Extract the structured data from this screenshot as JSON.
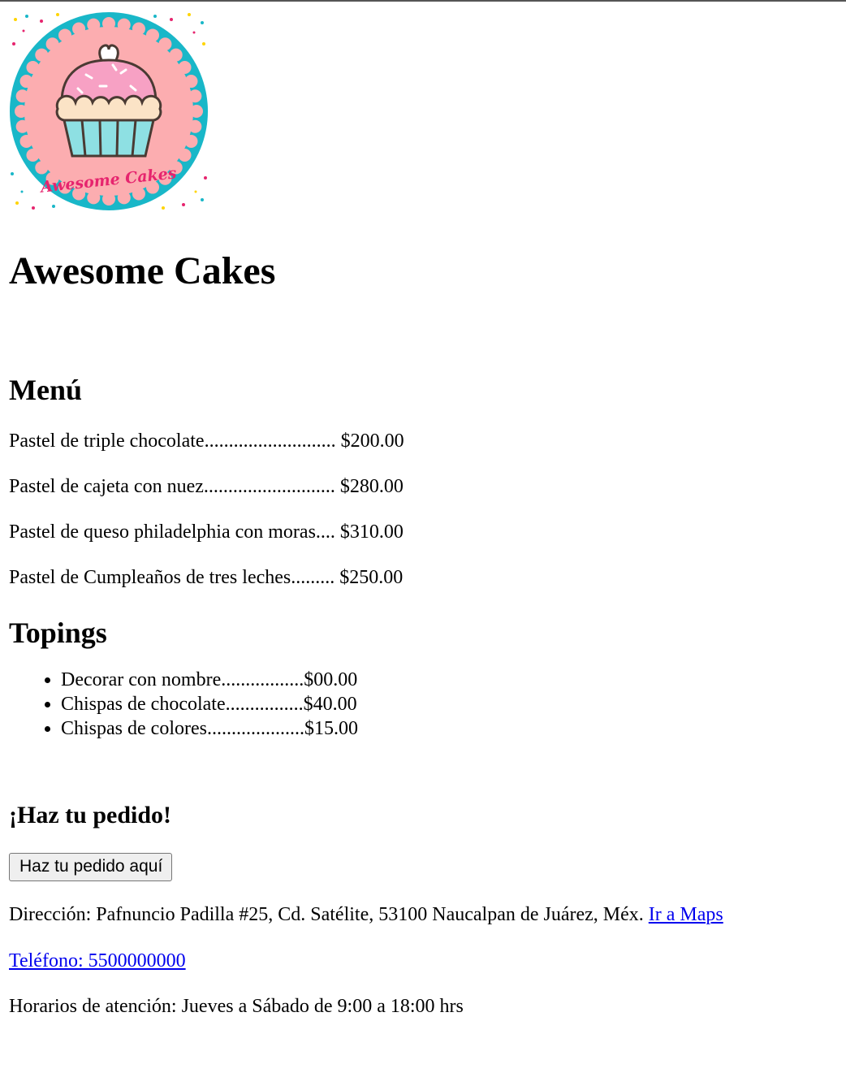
{
  "logo": {
    "text": "Awesome Cakes",
    "colors": {
      "ring": "#19b7c8",
      "inner": "#fcadb0",
      "frosting": "#f7a1c4",
      "cup": "#8ee0e3",
      "cream": "#fbe3c6",
      "outline": "#4a3a33",
      "script_text": "#e6246e"
    }
  },
  "title": "Awesome Cakes",
  "menu": {
    "heading": "Menú",
    "items": [
      "Pastel de triple chocolate........................... $200.00",
      "Pastel de cajeta con nuez........................... $280.00",
      "Pastel de queso philadelphia con moras.... $310.00",
      "Pastel de Cumpleaños de tres leches......... $250.00"
    ]
  },
  "topings": {
    "heading": "Topings",
    "items": [
      "Decorar con nombre.................$00.00",
      "Chispas de chocolate................$40.00",
      "Chispas de colores....................$15.00"
    ]
  },
  "order": {
    "heading": "¡Haz tu pedido!",
    "button_label": "Haz tu pedido aquí"
  },
  "contact": {
    "address_text": "Dirección: Pafnuncio Padilla #25, Cd. Satélite, 53100 Naucalpan de Juárez, Méx.",
    "maps_link": "Ir a Maps",
    "phone_link": "Teléfono: 5500000000",
    "hours": "Horarios de atención: Jueves a Sábado de 9:00 a 18:00 hrs"
  },
  "colors": {
    "link": "#0000ee",
    "text": "#000000",
    "button_bg": "#efefef"
  }
}
